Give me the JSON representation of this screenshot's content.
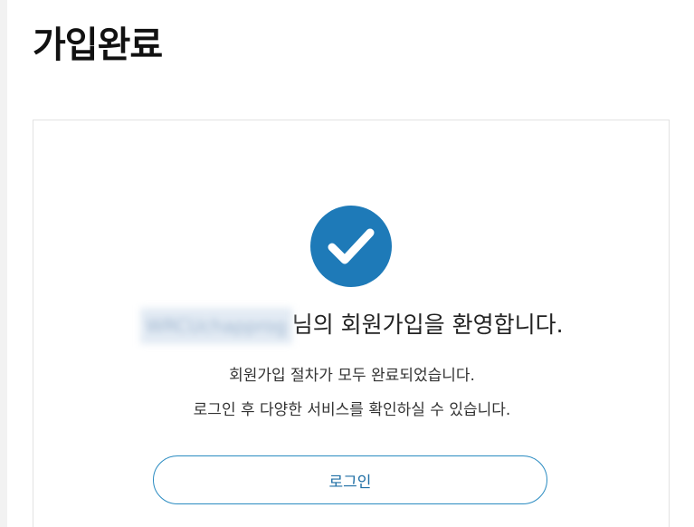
{
  "page": {
    "title": "가입완료"
  },
  "card": {
    "username_masked": "WRCUchapprog",
    "welcome_suffix": "님의 회원가입을 환영합니다.",
    "message_line1": "회원가입 절차가 모두 완료되었습니다.",
    "message_line2": "로그인 후 다양한 서비스를 확인하실 수 있습니다.",
    "login_label": "로그인",
    "check_icon": "check-circle-icon"
  },
  "colors": {
    "accent": "#1e7ab8",
    "button_border": "#2a8bc1",
    "button_text": "#1f6fa5"
  }
}
